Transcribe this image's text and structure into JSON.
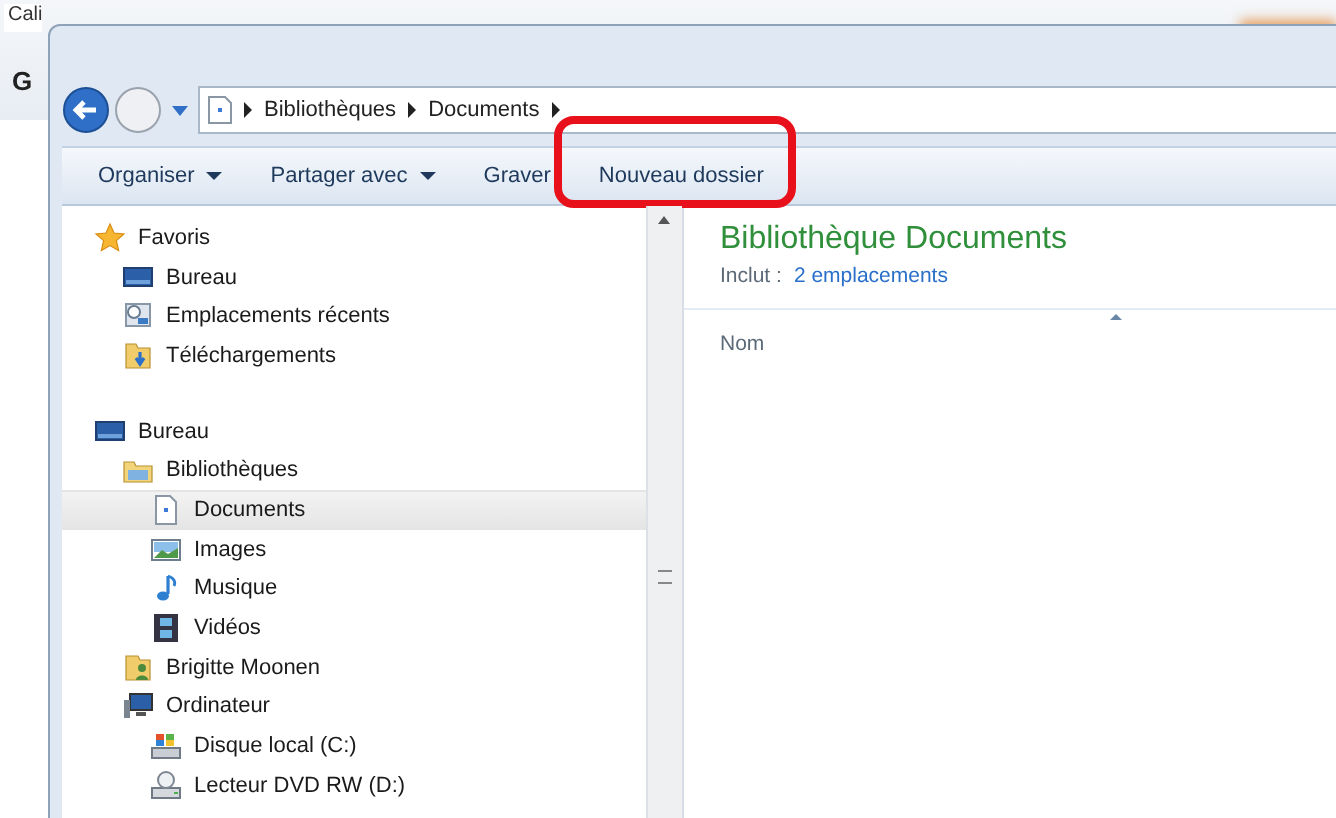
{
  "background_app": {
    "font_box": "Cali",
    "bold_key": "G"
  },
  "address_bar": {
    "path": [
      "Bibliothèques",
      "Documents"
    ]
  },
  "toolbar": [
    {
      "label": "Organiser",
      "has_menu": true,
      "highlighted": false
    },
    {
      "label": "Partager avec",
      "has_menu": true,
      "highlighted": false
    },
    {
      "label": "Graver",
      "has_menu": false,
      "highlighted": false
    },
    {
      "label": "Nouveau dossier",
      "has_menu": false,
      "highlighted": true
    }
  ],
  "navigation": [
    {
      "label": "Favoris",
      "kind": "star",
      "selected": false,
      "children": [
        {
          "label": "Bureau",
          "kind": "desktop",
          "selected": false
        },
        {
          "label": "Emplacements récents",
          "kind": "recent",
          "selected": false
        },
        {
          "label": "Téléchargements",
          "kind": "downloads",
          "selected": false
        }
      ]
    },
    {
      "label": "Bureau",
      "kind": "desktop",
      "selected": false,
      "children": [
        {
          "label": "Bibliothèques",
          "kind": "library",
          "selected": false,
          "children": [
            {
              "label": "Documents",
              "kind": "document",
              "selected": true
            },
            {
              "label": "Images",
              "kind": "images",
              "selected": false
            },
            {
              "label": "Musique",
              "kind": "music",
              "selected": false
            },
            {
              "label": "Vidéos",
              "kind": "videos",
              "selected": false
            }
          ]
        },
        {
          "label": "Brigitte Moonen",
          "kind": "user",
          "selected": false
        },
        {
          "label": "Ordinateur",
          "kind": "computer",
          "selected": false,
          "children": [
            {
              "label": "Disque local (C:)",
              "kind": "disk",
              "selected": false
            },
            {
              "label": "Lecteur DVD RW (D:)",
              "kind": "dvd",
              "selected": false
            }
          ]
        }
      ]
    }
  ],
  "library": {
    "title": "Bibliothèque Documents",
    "includes_label": "Inclut :",
    "includes_link": "2 emplacements"
  },
  "columns": [
    {
      "label": "Nom"
    }
  ]
}
